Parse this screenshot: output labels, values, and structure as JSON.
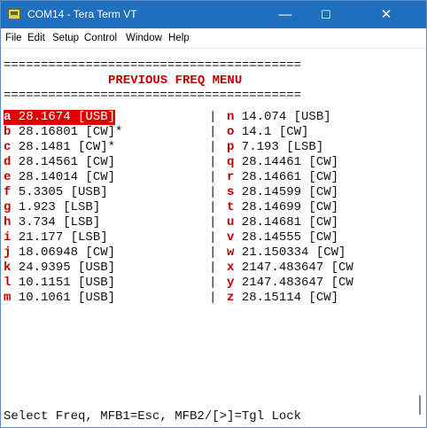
{
  "window": {
    "title": "COM14 - Tera Term VT"
  },
  "controls": {
    "minimize": "—",
    "maximize": "☐",
    "close": "✕"
  },
  "menu": [
    "File",
    "Edit",
    "Setup",
    "Control",
    "Window",
    "Help"
  ],
  "terminal": {
    "rule": "========================================",
    "heading": "PREVIOUS FREQ MENU",
    "left_column": [
      {
        "key": "a",
        "value": "28.1674 [USB]",
        "selected": true
      },
      {
        "key": "b",
        "value": "28.16801 [CW]*"
      },
      {
        "key": "c",
        "value": "28.1481 [CW]*"
      },
      {
        "key": "d",
        "value": "28.14561 [CW]"
      },
      {
        "key": "e",
        "value": "28.14014 [CW]"
      },
      {
        "key": "f",
        "value": "5.3305 [USB]"
      },
      {
        "key": "g",
        "value": "1.923 [LSB]"
      },
      {
        "key": "h",
        "value": "3.734 [LSB]"
      },
      {
        "key": "i",
        "value": "21.177 [LSB]"
      },
      {
        "key": "j",
        "value": "18.06948 [CW]"
      },
      {
        "key": "k",
        "value": "24.9395 [USB]"
      },
      {
        "key": "l",
        "value": "10.1151 [USB]"
      },
      {
        "key": "m",
        "value": "10.1061 [USB]"
      }
    ],
    "separator": "|",
    "right_column": [
      {
        "key": "n",
        "value": "14.074 [USB]"
      },
      {
        "key": "o",
        "value": "14.1 [CW]"
      },
      {
        "key": "p",
        "value": "7.193 [LSB]"
      },
      {
        "key": "q",
        "value": "28.14461 [CW]"
      },
      {
        "key": "r",
        "value": "28.14661 [CW]"
      },
      {
        "key": "s",
        "value": "28.14599 [CW]"
      },
      {
        "key": "t",
        "value": "28.14699 [CW]"
      },
      {
        "key": "u",
        "value": "28.14681 [CW]"
      },
      {
        "key": "v",
        "value": "28.14555 [CW]"
      },
      {
        "key": "w",
        "value": "21.150334 [CW]"
      },
      {
        "key": "x",
        "value": "2147.483647 [CW"
      },
      {
        "key": "y",
        "value": "2147.483647 [CW"
      },
      {
        "key": "z",
        "value": "28.15114 [CW]"
      }
    ],
    "status_line": "Select Freq, MFB1=Esc, MFB2/[>]=Tgl Lock"
  }
}
